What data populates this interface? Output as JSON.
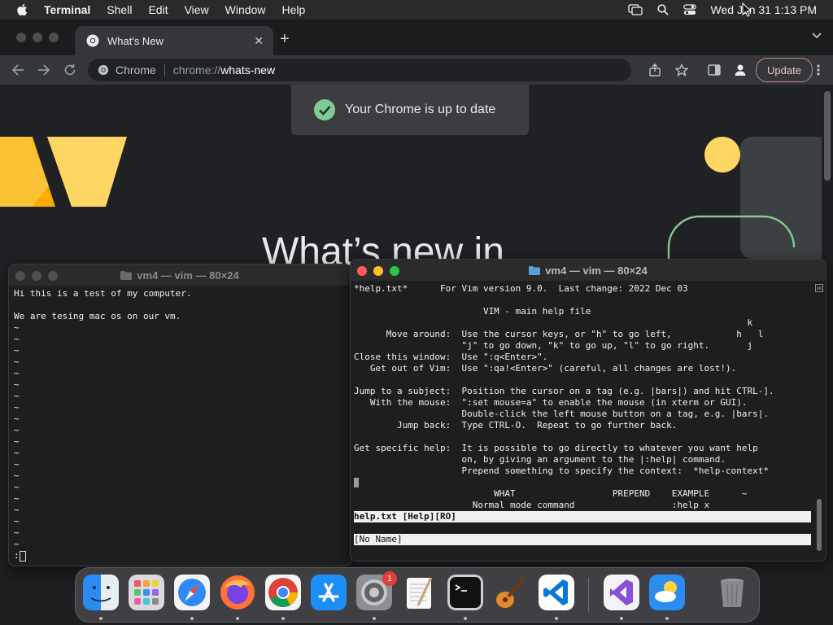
{
  "menubar": {
    "app": "Terminal",
    "items": [
      "Shell",
      "Edit",
      "View",
      "Window",
      "Help"
    ],
    "clock": "Wed Jan 31  1:13 PM"
  },
  "chrome": {
    "tab_title": "What's New",
    "omnibox_site": "Chrome",
    "omnibox_scheme": "chrome://",
    "omnibox_path": "whats-new",
    "update_label": "Update",
    "toast_text": "Your Chrome is up to date",
    "headline": "What’s new in"
  },
  "terminal_left": {
    "title": "vm4 — vim — 80×24",
    "lines": [
      "Hi this is a test of my computer.",
      "",
      "We are tesing mac os on our vm.",
      "~",
      "~",
      "~",
      "~",
      "~",
      "~",
      "~",
      "~",
      "~",
      "~",
      "~",
      "~",
      "~",
      "~",
      "~",
      "~",
      "~",
      "~",
      "~",
      "~",
      ":"
    ]
  },
  "terminal_right": {
    "title": "vm4 — vim — 80×24",
    "lines": [
      "*help.txt*      For Vim version 9.0.  Last change: 2022 Dec 03",
      "",
      "                        VIM - main help file",
      "                                                                         k",
      "      Move around:  Use the cursor keys, or \"h\" to go left,            h   l",
      "                    \"j\" to go down, \"k\" to go up, \"l\" to go right.       j",
      "Close this window:  Use \":q<Enter>\".",
      "   Get out of Vim:  Use \":qa!<Enter>\" (careful, all changes are lost!).",
      "",
      "Jump to a subject:  Position the cursor on a tag (e.g. |bars|) and hit CTRL-].",
      "   With the mouse:  \":set mouse=a\" to enable the mouse (in xterm or GUI).",
      "                    Double-click the left mouse button on a tag, e.g. |bars|.",
      "        Jump back:  Type CTRL-O.  Repeat to go further back.",
      "",
      "Get specific help:  It is possible to go directly to whatever you want help",
      "                    on, by giving an argument to the |:help| command.",
      "                    Prepend something to specify the context:  *help-context*",
      "",
      "                          WHAT                  PREPEND    EXAMPLE      ~",
      "                      Normal mode command                  :help x"
    ],
    "status_help": "help.txt [Help][RO]",
    "status_noname": "[No Name]"
  },
  "dock": {
    "apps": [
      "Finder",
      "Launchpad",
      "Safari",
      "Firefox",
      "Google Chrome",
      "App Store",
      "System Settings",
      "TextEdit",
      "Terminal",
      "Instruments",
      "Visual Studio Code",
      "Visual Studio",
      "Weather",
      "Trash"
    ],
    "settings_badge": "1"
  },
  "colors": {
    "chrome_bg": "#202124",
    "terminal_bg": "#1e1e1e",
    "yellow_accent": "#fdd663",
    "orange_accent": "#f9ab00",
    "green_accent": "#81c995"
  }
}
